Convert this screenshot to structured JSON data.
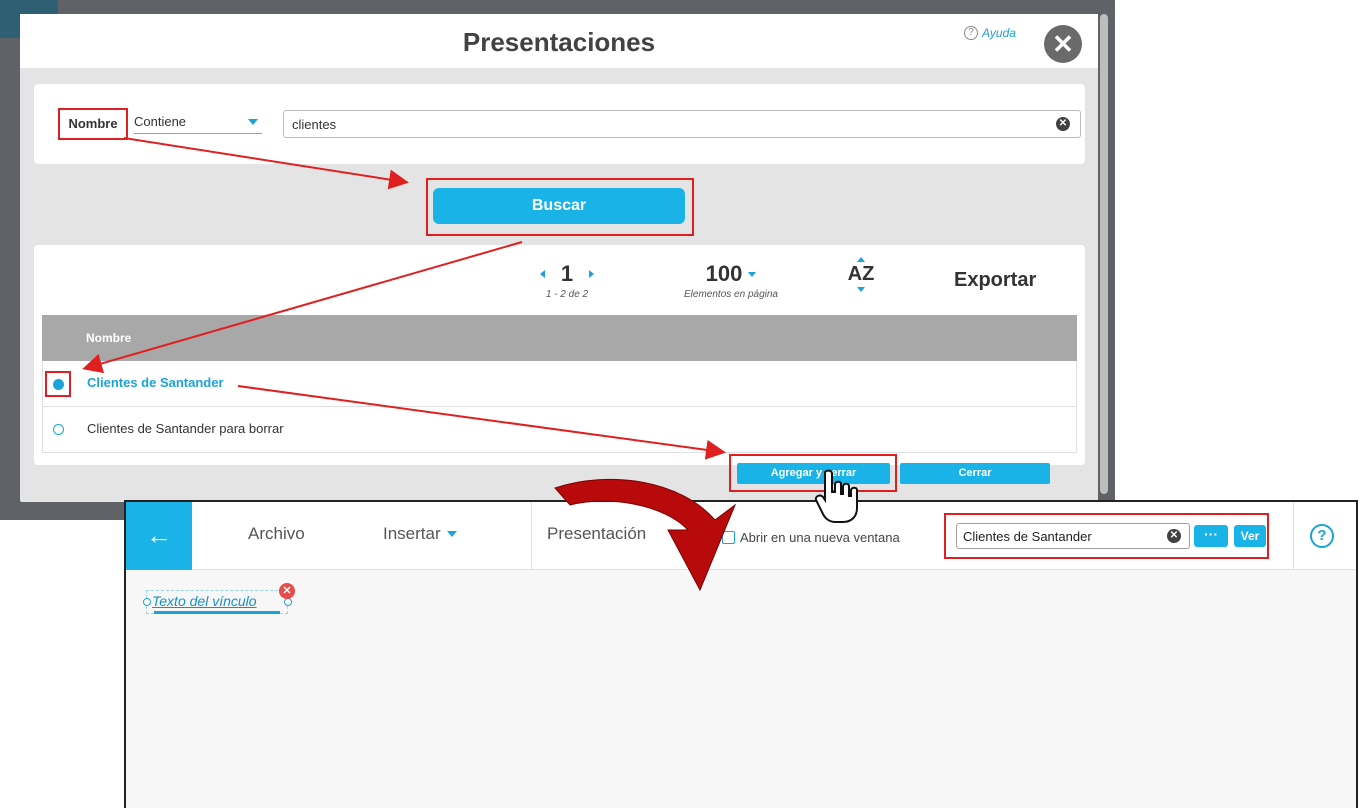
{
  "modal": {
    "title": "Presentaciones",
    "help_label": "Ayuda",
    "close_glyph": "✕"
  },
  "filter": {
    "field_label": "Nombre",
    "operator": "Contiene",
    "value": "clientes",
    "clear_glyph": "✕",
    "search_button": "Buscar"
  },
  "results": {
    "page": "1",
    "range": "1 - 2 de 2",
    "per_page": "100",
    "per_page_label": "Elementos en página",
    "sort_label": "AZ",
    "export_label": "Exportar",
    "column_header": "Nombre",
    "rows": [
      {
        "label": "Clientes de Santander",
        "selected": true
      },
      {
        "label": "Clientes de Santander para borrar",
        "selected": false
      }
    ],
    "add_close_button": "Agregar y cerrar",
    "close_button": "Cerrar"
  },
  "editor": {
    "back_glyph": "←",
    "menu": {
      "file": "Archivo",
      "insert": "Insertar",
      "presentation": "Presentación"
    },
    "new_window_label": "Abrir en una nueva ventana",
    "linked_value": "Clientes de Santander",
    "dots_label": "···",
    "view_button": "Ver",
    "help_glyph": "?",
    "link_text": "Texto del vínculo"
  },
  "colors": {
    "accent": "#1ab3e8",
    "annotation": "#e02020",
    "big_arrow": "#b80a0a"
  }
}
